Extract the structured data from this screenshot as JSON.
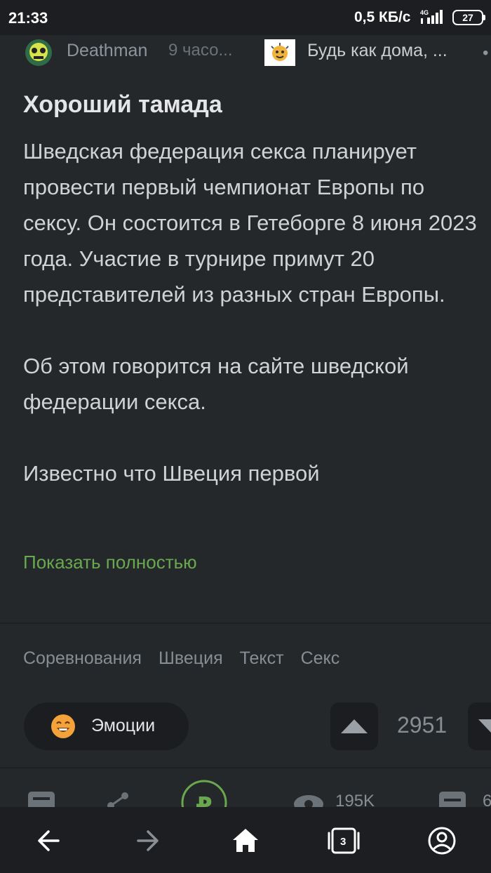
{
  "status_bar": {
    "time": "21:33",
    "speed": "0,5 КБ/с",
    "network": "4G",
    "battery": "27"
  },
  "post": {
    "author": "Deathman",
    "time_ago": "9 часо...",
    "community": "Будь как дома, ...",
    "title": "Хороший тамада",
    "paragraphs": [
      "Шведская федерация секса планирует провести первый чемпионат Европы по сексу. Он состоится в Гетеборге 8 июня 2023 года. Участие в турнире примут 20 представителей из разных стран Европы.",
      "Об этом говорится на сайте  шведской федерации секса.",
      "Известно что Швеция первой"
    ],
    "show_full": "Показать полностью",
    "tags": [
      "Соревнования",
      "Швеция",
      "Текст",
      "Секс"
    ],
    "emotions_label": "Эмоции",
    "rating": "2951",
    "views": "195K",
    "saved_count": "6"
  },
  "nav": {
    "tabs_count": "3"
  },
  "colors": {
    "background": "#25282b",
    "accent_green": "#6aa84f",
    "bar": "#1c1e21"
  }
}
